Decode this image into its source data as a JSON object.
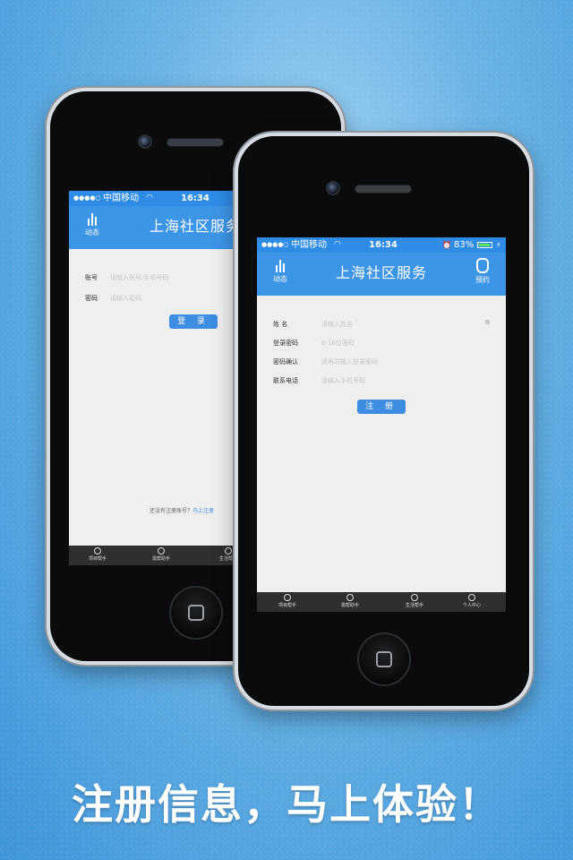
{
  "back_phone": {
    "status": {
      "signal": "●●●●○",
      "carrier": "中国移动",
      "time": "16:34"
    },
    "nav": {
      "left_label": "动态",
      "title": "上海社区服务"
    },
    "form": {
      "account_label": "账号",
      "account_placeholder": "请输入账号/手机号码",
      "password_label": "密码",
      "password_placeholder": "请输入密码"
    },
    "login_button": "登 录",
    "register_prompt": "还没有注册账号？",
    "register_link": "马上注册",
    "tabs": [
      "项目帮手",
      "需帮助手",
      "生活帮手"
    ]
  },
  "front_phone": {
    "status": {
      "signal": "●●●●○",
      "carrier": "中国移动",
      "time": "16:34",
      "battery": "83%"
    },
    "nav": {
      "left_label": "动态",
      "title": "上海社区服务",
      "right_label": "预约"
    },
    "form": {
      "name_label": "姓  名",
      "name_placeholder": "请输入姓名",
      "password_label": "登录密码",
      "password_placeholder": "6-16位密码",
      "confirm_label": "密码确认",
      "confirm_placeholder": "请再次输入登录密码",
      "phone_label": "联系电话",
      "phone_placeholder": "请输入手机号码"
    },
    "register_button": "注 册",
    "tabs": [
      "项目帮手",
      "需帮助手",
      "生活帮手",
      "个人中心"
    ]
  },
  "caption": "注册信息，马上体验！",
  "colors": {
    "nav": "#3d95e8",
    "status": "#2f8ce6",
    "button": "#3d8ee3",
    "tabbar": "#2e2f31"
  }
}
